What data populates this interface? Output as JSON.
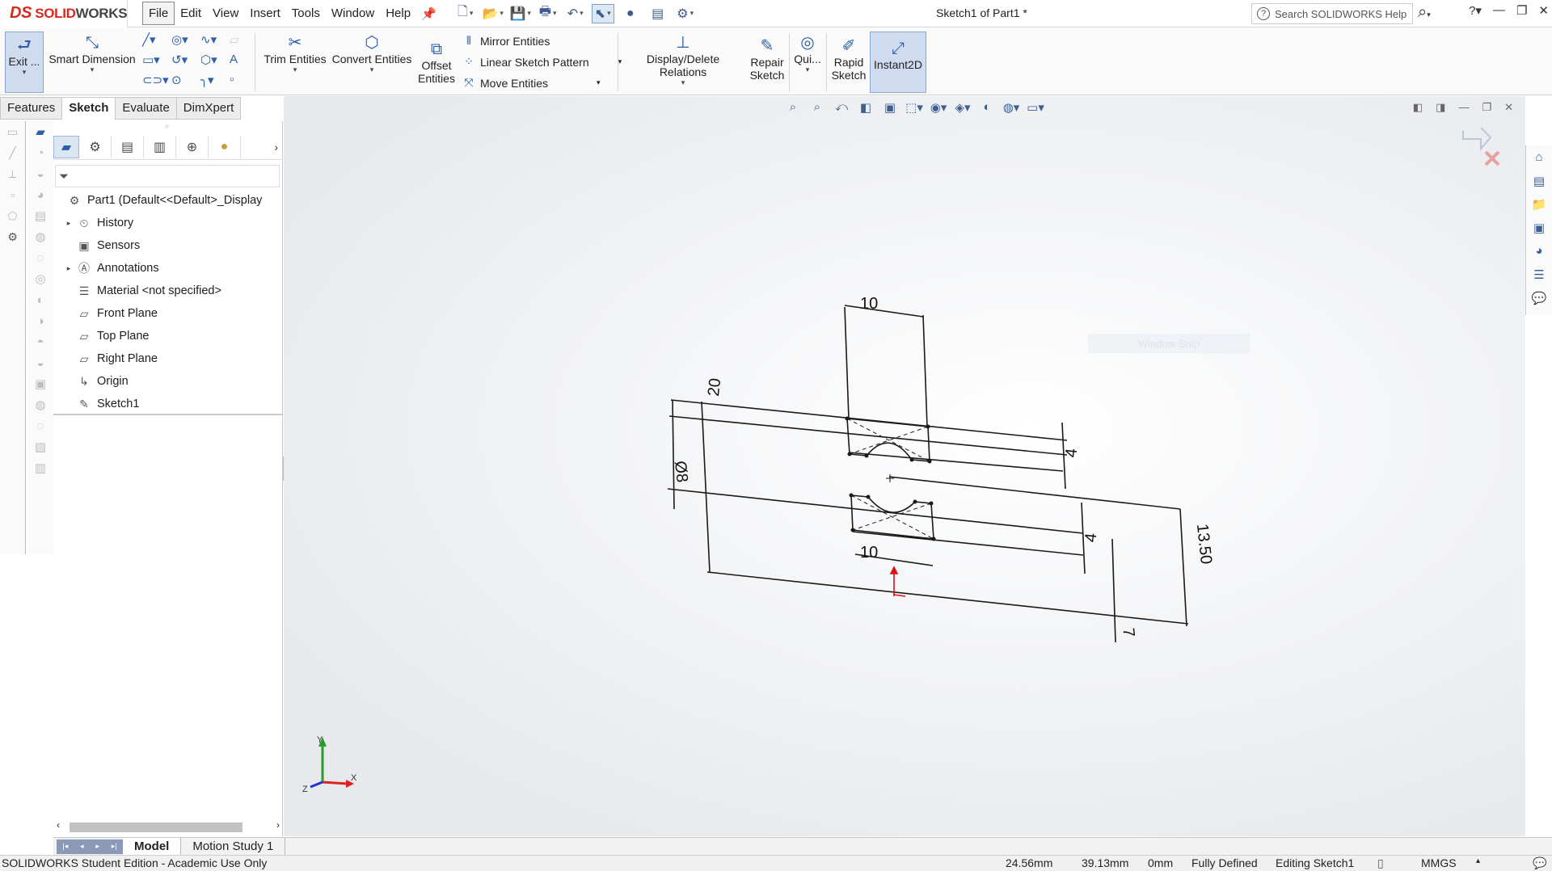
{
  "app": {
    "brand_prefix": "DS",
    "brand_solid": "SOLID",
    "brand_works": "WORKS",
    "doc_title": "Sketch1 of Part1 *"
  },
  "menu": [
    "File",
    "Edit",
    "View",
    "Insert",
    "Tools",
    "Window",
    "Help"
  ],
  "search": {
    "placeholder": "Search SOLIDWORKS Help"
  },
  "commands": {
    "exit_sketch": "Exit ...",
    "smart_dimension": "Smart Dimension",
    "trim_entities": "Trim Entities",
    "convert_entities": "Convert Entities",
    "offset_entities_1": "Offset",
    "offset_entities_2": "Entities",
    "mirror_entities": "Mirror Entities",
    "linear_sketch_pattern": "Linear Sketch Pattern",
    "move_entities": "Move Entities",
    "display_delete_relations": "Display/Delete Relations",
    "repair_sketch_1": "Repair",
    "repair_sketch_2": "Sketch",
    "quick_snaps": "Qui...",
    "rapid_sketch_1": "Rapid",
    "rapid_sketch_2": "Sketch",
    "instant2d": "Instant2D"
  },
  "tabs": [
    "Features",
    "Sketch",
    "Evaluate",
    "DimXpert"
  ],
  "active_tab": "Sketch",
  "tree": {
    "root": "Part1  (Default<<Default>_Display",
    "items": [
      {
        "label": "History",
        "expandable": true,
        "icon": "history-icon"
      },
      {
        "label": "Sensors",
        "expandable": false,
        "icon": "sensors-icon"
      },
      {
        "label": "Annotations",
        "expandable": true,
        "icon": "annotations-icon"
      },
      {
        "label": "Material <not specified>",
        "expandable": false,
        "icon": "material-icon"
      },
      {
        "label": "Front Plane",
        "expandable": false,
        "icon": "plane-icon"
      },
      {
        "label": "Top Plane",
        "expandable": false,
        "icon": "plane-icon"
      },
      {
        "label": "Right Plane",
        "expandable": false,
        "icon": "plane-icon"
      },
      {
        "label": "Origin",
        "expandable": false,
        "icon": "origin-icon"
      },
      {
        "label": "Sketch1",
        "expandable": false,
        "icon": "sketch-icon"
      }
    ]
  },
  "viewport": {
    "window_snip": "Window Snip",
    "dimensions": [
      "10",
      "20",
      "4",
      "Ø8",
      "13.50",
      "10",
      "4",
      "7"
    ],
    "triad": {
      "x": "X",
      "y": "Y",
      "z": "Z"
    }
  },
  "bottom_tabs": [
    "Model",
    "Motion Study 1"
  ],
  "status": {
    "edition": "SOLIDWORKS Student Edition - Academic Use Only",
    "x": "24.56mm",
    "y": "39.13mm",
    "z": "0mm",
    "state": "Fully Defined",
    "editing": "Editing Sketch1",
    "units": "MMGS"
  },
  "colors": {
    "brand": "#d52b1e",
    "accent": "#2d5ea8",
    "selected_bg": "#cfdcef"
  }
}
